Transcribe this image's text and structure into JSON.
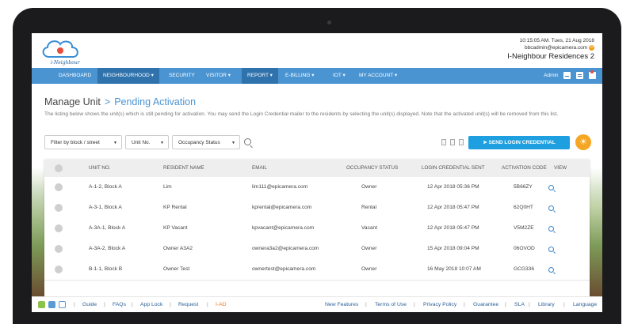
{
  "header": {
    "app_name": "i-Neighbour",
    "datetime": "10:15:05 AM. Tues, 21 Aug 2018",
    "user_email": "bbcadmin@epicamera.com",
    "estate": "I-Neighbour Residences 2"
  },
  "nav": {
    "items": [
      "DASHBOARD",
      "NEIGHBOURHOOD ▾",
      "SECURITY",
      "VISITOR ▾",
      "REPORT ▾",
      "E-BILLING ▾",
      "IOT ▾",
      "MY ACCOUNT ▾"
    ],
    "active": "NEIGHBOURHOOD",
    "user_label": "Admin"
  },
  "page": {
    "title": "Manage Unit",
    "separator": ">",
    "subtitle": "Pending Activation",
    "description": "The listing below shows the unit(s) which is still pending for activation. You may send the Login Credential mailer to the residents by selecting the unit(s) displayed. Note that the activated unit(s) will be removed from this list."
  },
  "filters": {
    "block_street": "Filter by block / street",
    "unit_no": "Unit No.",
    "occupancy": "Occupancy Status"
  },
  "actions": {
    "send_label": "SEND LOGIN CREDENTIAL"
  },
  "table": {
    "headers": [
      "UNIT NO.",
      "RESIDENT NAME",
      "EMAIL",
      "OCCUPANCY STATUS",
      "LOGIN CREDENTIAL SENT",
      "ACTIVATION CODE",
      "VIEW"
    ],
    "rows": [
      {
        "unit": "A-1-2, Block A",
        "name": "Lim",
        "email": "lim111@epicamera.com",
        "status": "Owner",
        "sent": "12 Apr 2018 05:36 PM",
        "code": "5B66ZY"
      },
      {
        "unit": "A-3-1, Block A",
        "name": "KP Rental",
        "email": "kprental@epicamera.com",
        "status": "Rental",
        "sent": "12 Apr 2018 05:47 PM",
        "code": "62Q0HT"
      },
      {
        "unit": "A-3A-1, Block A",
        "name": "KP Vacant",
        "email": "kpvacant@epicamera.com",
        "status": "Vacant",
        "sent": "12 Apr 2018 05:47 PM",
        "code": "V5M2ZE"
      },
      {
        "unit": "A-3A-2, Block A",
        "name": "Owner A3A2",
        "email": "ownera3a2@epicamera.com",
        "status": "Owner",
        "sent": "15 Apr 2018 09:04 PM",
        "code": "06OVOD"
      },
      {
        "unit": "B-1-1, Block B",
        "name": "Owner Test",
        "email": "ownertest@epicamera.com",
        "status": "Owner",
        "sent": "16 May 2018 10:07 AM",
        "code": "GCG336"
      }
    ]
  },
  "footer": {
    "left_links": [
      "Guide",
      "FAQs",
      "App Lock",
      "Request",
      "I-AD"
    ],
    "right_links": [
      "New Features",
      "Terms of Use",
      "Privacy Policy",
      "Guarantee",
      "SLA",
      "Library",
      "Language"
    ],
    "colors": {
      "link": "#2b5f96",
      "highlight": "#e67e22"
    }
  },
  "colors": {
    "nav": "#4a94d2",
    "nav_active": "#2f72ac",
    "primary_button": "#1d9fe0",
    "bulb": "#f5a623"
  }
}
